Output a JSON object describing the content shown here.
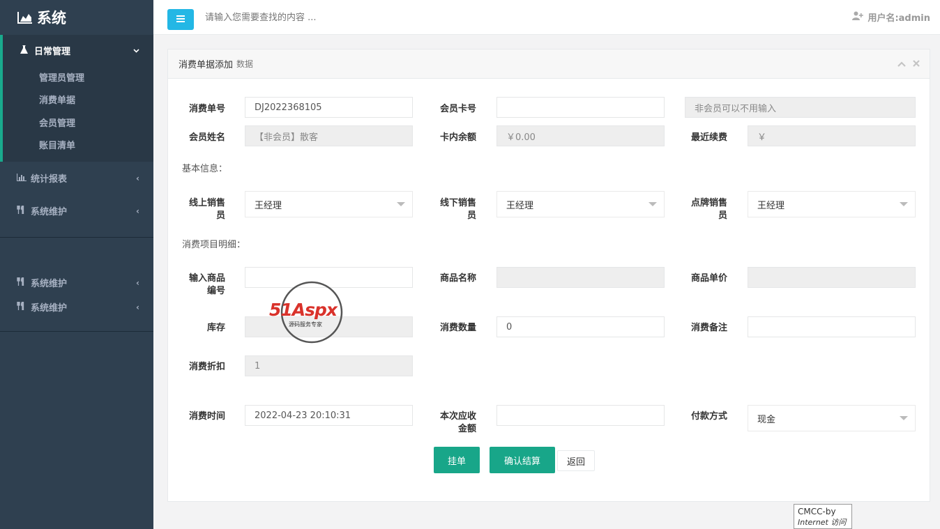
{
  "sidebar": {
    "brand": "系统",
    "open_group": {
      "label": "日常管理",
      "items": [
        "管理员管理",
        "消费单据",
        "会员管理",
        "账目清单"
      ]
    },
    "groups": [
      {
        "label": "统计报表"
      },
      {
        "label": "系统维护"
      }
    ],
    "groups2": [
      {
        "label": "系统维护"
      },
      {
        "label": "系统维护"
      }
    ]
  },
  "topbar": {
    "search_placeholder": "请输入您需要查找的内容 ...",
    "user": "用户名:admin"
  },
  "panel": {
    "title": "消费单据添加",
    "title_small": "数据"
  },
  "form": {
    "order_no_label": "消费单号",
    "order_no_value": "DJ2022368105",
    "card_no_label": "会员卡号",
    "card_no_value": "",
    "card_hint": "非会员可以不用输入",
    "member_name_label": "会员姓名",
    "member_name_value": "【非会员】散客",
    "balance_label": "卡内余额",
    "balance_value": "￥0.00",
    "recent_label": "最近续费",
    "recent_value": "￥",
    "basic_info": "基本信息：",
    "online_sales_label_1": "线上销售",
    "online_sales_label_2": "员",
    "online_sales_value": "王经理",
    "offline_sales_label_1": "线下销售",
    "offline_sales_label_2": "员",
    "offline_sales_value": "王经理",
    "tag_sales_label_1": "点牌销售",
    "tag_sales_label_2": "员",
    "tag_sales_value": "王经理",
    "items_detail": "消费项目明细：",
    "product_code_label_1": "输入商品",
    "product_code_label_2": "编号",
    "product_code_value": "",
    "product_name_label": "商品名称",
    "product_name_value": "",
    "unit_price_label": "商品单价",
    "unit_price_value": "",
    "stock_label": "库存",
    "stock_value": "",
    "qty_label": "消费数量",
    "qty_value": "0",
    "remark_label": "消费备注",
    "remark_value": "",
    "discount_label": "消费折扣",
    "discount_value": "1",
    "time_label": "消费时间",
    "time_value": "2022-04-23 20:10:31",
    "receivable_label_1": "本次应收",
    "receivable_label_2": "金额",
    "receivable_value": "",
    "payment_label": "付款方式",
    "payment_value": "现金"
  },
  "buttons": {
    "hold": "挂单",
    "confirm": "确认结算",
    "back": "返回"
  },
  "watermark": {
    "logo_text": "51Aspx",
    "sub_text": "源码服务专家"
  },
  "tooltip": {
    "line1": "CMCC-by",
    "line2": "Internet 访问"
  },
  "colors": {
    "sidebar_bg": "#2f4050",
    "accent_green": "#18a689",
    "menu_btn": "#23b7e5"
  }
}
